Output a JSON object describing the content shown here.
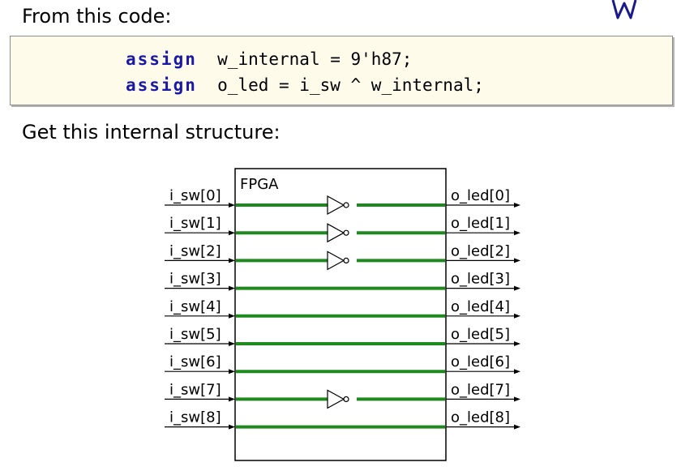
{
  "heading_code": "From this code:",
  "heading_structure": "Get this internal structure:",
  "code": [
    {
      "keyword": "assign",
      "rest": "w_internal = 9'h87;"
    },
    {
      "keyword": "assign",
      "rest": "o_led = i_sw ^ w_internal;"
    }
  ],
  "fpga_label": "FPGA",
  "inputs": [
    "i_sw[0]",
    "i_sw[1]",
    "i_sw[2]",
    "i_sw[3]",
    "i_sw[4]",
    "i_sw[5]",
    "i_sw[6]",
    "i_sw[7]",
    "i_sw[8]"
  ],
  "outputs": [
    "o_led[0]",
    "o_led[1]",
    "o_led[2]",
    "o_led[3]",
    "o_led[4]",
    "o_led[5]",
    "o_led[6]",
    "o_led[7]",
    "o_led[8]"
  ],
  "inverted": [
    true,
    true,
    true,
    false,
    false,
    false,
    false,
    true,
    false
  ],
  "colors": {
    "wire": "#1e8a1e",
    "keyword": "#1a1aa6",
    "code_bg": "#fffbeb",
    "logo": "#1a1a8c"
  }
}
